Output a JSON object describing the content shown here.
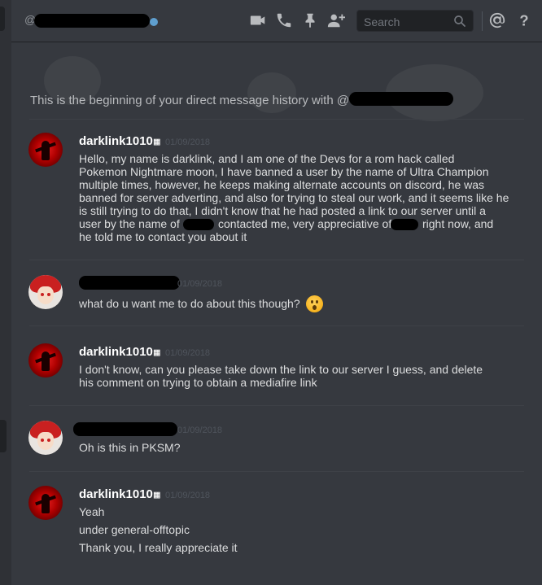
{
  "header": {
    "at_symbol": "@",
    "search_placeholder": "Search",
    "icons": [
      "video-icon",
      "phone-icon",
      "pin-icon",
      "add-friend-icon",
      "search-icon",
      "mention-icon",
      "help-icon"
    ],
    "status_color": "#5f9fcf"
  },
  "conversation": {
    "beginning_text": "This is the beginning of your direct message history with @"
  },
  "messages": [
    {
      "author": "darklink1010",
      "author_glyph": "▦",
      "timestamp": "01/09/2018",
      "lines": "Hello, my name is darklink, and I am one of the Devs for a rom hack called\nPokemon Nightmare moon, I have banned a user by the name of Ultra Champion\nmultiple times, however, he keeps making alternate accounts on discord, he was\nbanned for server adverting, and also for trying to steal our work, and it seems like he\nis still trying to do that, I didn't know that he had posted a link to our server until a\nuser by the name of",
      "line_6b": "contacted me, very appreciative of",
      "line_6c": "right now, and",
      "line_7": "he told me to contact you about it",
      "avatar": "red"
    },
    {
      "author": "",
      "timestamp": "01/09/2018",
      "lines": "what do u want me to do about this though?",
      "emoji": "hushed-face-emoji",
      "avatar": "anime"
    },
    {
      "author": "darklink1010",
      "author_glyph": "▦",
      "timestamp": "01/09/2018",
      "lines": "I don't know, can you please take down the link to our server I guess, and delete\nhis comment on trying to obtain a mediafire link",
      "avatar": "red"
    },
    {
      "author": "",
      "timestamp": "01/09/2018",
      "lines": "Oh is this in PKSM?",
      "avatar": "anime"
    },
    {
      "author": "darklink1010",
      "author_glyph": "▦",
      "timestamp": "01/09/2018",
      "line_a": "Yeah",
      "line_b": "under general-offtopic",
      "line_c": "Thank you, I really appreciate it",
      "avatar": "red"
    }
  ]
}
